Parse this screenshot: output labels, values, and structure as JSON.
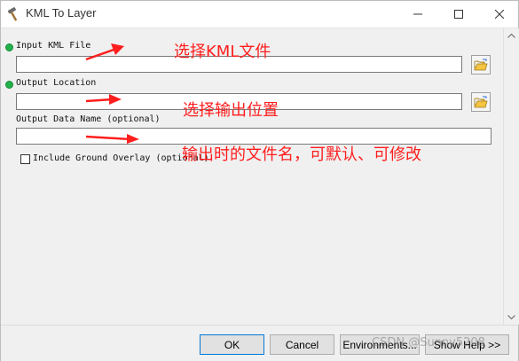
{
  "window": {
    "title": "KML To Layer",
    "icon": "hammer-icon"
  },
  "fields": {
    "input_kml": {
      "label": "Input KML File",
      "value": "",
      "required": true
    },
    "output_location": {
      "label": "Output Location",
      "value": "",
      "required": true
    },
    "output_name": {
      "label": "Output Data Name (optional)",
      "value": ""
    },
    "ground_overlay": {
      "label": "Include Ground Overlay (optional)",
      "checked": false
    }
  },
  "annotations": {
    "select_kml": "选择KML文件",
    "select_location": "选择输出位置",
    "output_name_note": "输出时的文件名，可默认、可修改"
  },
  "buttons": {
    "ok": "OK",
    "cancel": "Cancel",
    "environments": "Environments...",
    "show_help": "Show Help >>"
  },
  "watermark": "CSDN @Sunny5208",
  "colors": {
    "annotation": "#ff1e1e",
    "required_dot": "#22b14c",
    "accent": "#0078d7"
  }
}
